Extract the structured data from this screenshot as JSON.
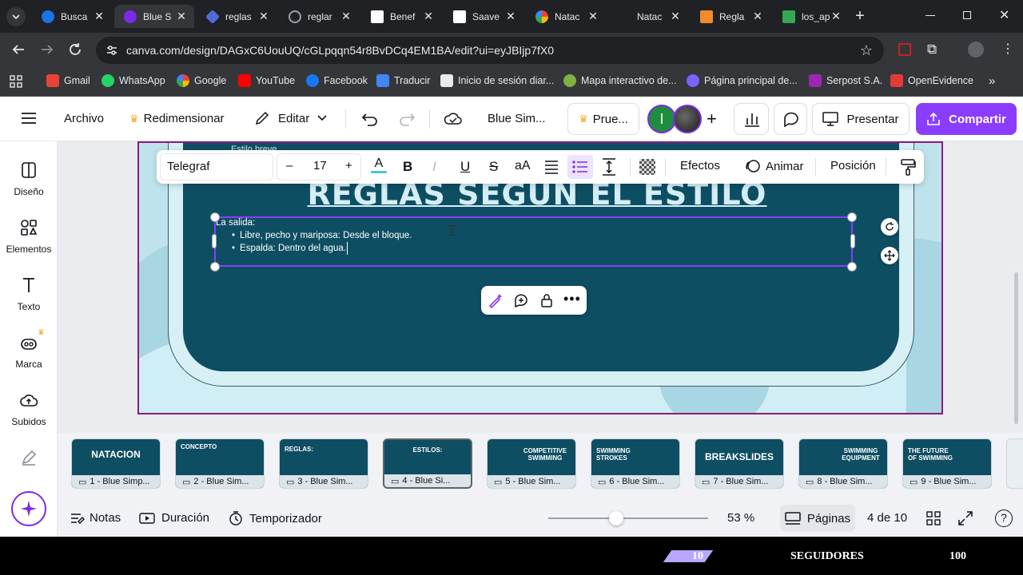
{
  "tabs": [
    {
      "title": "Busca",
      "color": "#1a73e8"
    },
    {
      "title": "Blue S",
      "color": "#7d2ae8"
    },
    {
      "title": "reglas",
      "color": "#4f6bd8"
    },
    {
      "title": "reglar",
      "color": "#9aa0a6"
    },
    {
      "title": "Benef",
      "color": "#c5221f"
    },
    {
      "title": "Saave",
      "color": "#ffffff"
    },
    {
      "title": "Natac",
      "color": "#ea4335"
    },
    {
      "title": "Natac",
      "color": "#202124"
    },
    {
      "title": "Regla",
      "color": "#f28b30"
    },
    {
      "title": "los_ap",
      "color": "#34a853"
    }
  ],
  "address_bar": {
    "url": "canva.com/design/DAGxC6UouUQ/cGLpqqn54r8BvDCq4EM1BA/edit?ui=eyJBIjp7fX0"
  },
  "bookmarks": [
    {
      "label": "Gmail",
      "color": "#ea4335"
    },
    {
      "label": "WhatsApp",
      "color": "#25d366"
    },
    {
      "label": "Google",
      "color": "#4285f4"
    },
    {
      "label": "YouTube",
      "color": "#ff0000"
    },
    {
      "label": "Facebook",
      "color": "#1877f2"
    },
    {
      "label": "Traducir",
      "color": "#4285f4"
    },
    {
      "label": "Inicio de sesión diar...",
      "color": "#e8eaed"
    },
    {
      "label": "Mapa interactivo de...",
      "color": "#7cb342"
    },
    {
      "label": "Página principal de...",
      "color": "#7b61ff"
    },
    {
      "label": "Serpost S.A.",
      "color": "#9c27b0"
    },
    {
      "label": "OpenEvidence",
      "color": "#e53935"
    }
  ],
  "topbar": {
    "archivo": "Archivo",
    "redimensionar": "Redimensionar",
    "editar": "Editar",
    "doc_title": "Blue Sim...",
    "trial": "Prue...",
    "avatar_letter": "I",
    "presentar": "Presentar",
    "compartir": "Compartir"
  },
  "sidebar": [
    {
      "label": "Diseño",
      "icon": "layout-icon"
    },
    {
      "label": "Elementos",
      "icon": "shapes-icon"
    },
    {
      "label": "Texto",
      "icon": "text-icon"
    },
    {
      "label": "Marca",
      "icon": "brand-icon"
    },
    {
      "label": "Subidos",
      "icon": "cloud-upload-icon"
    }
  ],
  "text_toolbar": {
    "font": "Telegraf",
    "minus": "–",
    "size": "17",
    "plus": "+",
    "effects": "Efectos",
    "animate": "Animar",
    "position": "Posición"
  },
  "slide": {
    "partial_text": "Estilo breve",
    "title": "REGLAS SEGUN EL ESTILO",
    "subtitle": "La salida:",
    "bullets": [
      "Libre, pecho y mariposa: Desde el bloque.",
      "Espalda: Dentro del agua."
    ]
  },
  "thumbnails": [
    {
      "title": "NATACION",
      "caption": "1 - Blue Simp..."
    },
    {
      "title": "CONCEPTO",
      "caption": "2 - Blue Sim..."
    },
    {
      "title": "REGLAS:",
      "caption": "3 - Blue Sim..."
    },
    {
      "title": "ESTILOS:",
      "caption": "4 - Blue Si..."
    },
    {
      "title": "COMPETITIVE SWIMMING",
      "caption": "5 - Blue Sim..."
    },
    {
      "title": "SWIMMING STROKES",
      "caption": "6 - Blue Sim..."
    },
    {
      "title": "BREAKSLIDES",
      "caption": "7 - Blue Sim..."
    },
    {
      "title": "SWIMMING EQUIPMENT",
      "caption": "8 - Blue Sim..."
    },
    {
      "title": "THE FUTURE OF SWIMMING",
      "caption": "9 - Blue Sim..."
    }
  ],
  "bottombar": {
    "notas": "Notas",
    "duracion": "Duración",
    "temporizador": "Temporizador",
    "zoom": "53 %",
    "zoom_level": 0.5,
    "paginas": "Páginas",
    "page_count": "4 de 10"
  },
  "stream_overlay": {
    "count": "10",
    "label": "SEGUIDORES",
    "goal": "100"
  },
  "colors": {
    "canva_purple": "#7d2ae8",
    "slide_teal": "#0e4e63",
    "selection": "#8b3dff"
  }
}
